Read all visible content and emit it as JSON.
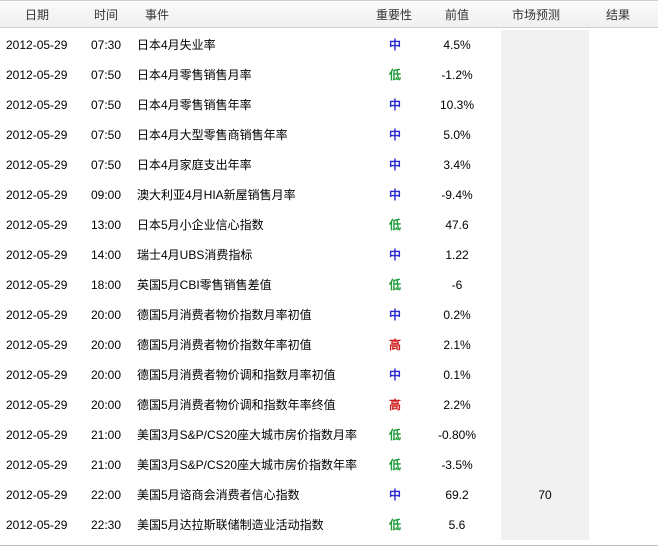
{
  "header": {
    "date": "日期",
    "time": "时间",
    "event": "事件",
    "importance": "重要性",
    "previous": "前值",
    "forecast": "市场预测",
    "actual": "结果"
  },
  "importance_colors": {
    "中": "#2a2ad0",
    "低": "#1f9a3a",
    "高": "#d01c1c"
  },
  "rows": [
    {
      "date": "2012-05-29",
      "time": "07:30",
      "event": "日本4月失业率",
      "importance": "中",
      "previous": "4.5%",
      "forecast": "",
      "actual": ""
    },
    {
      "date": "2012-05-29",
      "time": "07:50",
      "event": "日本4月零售销售月率",
      "importance": "低",
      "previous": "-1.2%",
      "forecast": "",
      "actual": ""
    },
    {
      "date": "2012-05-29",
      "time": "07:50",
      "event": "日本4月零售销售年率",
      "importance": "中",
      "previous": "10.3%",
      "forecast": "",
      "actual": ""
    },
    {
      "date": "2012-05-29",
      "time": "07:50",
      "event": "日本4月大型零售商销售年率",
      "importance": "中",
      "previous": "5.0%",
      "forecast": "",
      "actual": ""
    },
    {
      "date": "2012-05-29",
      "time": "07:50",
      "event": "日本4月家庭支出年率",
      "importance": "中",
      "previous": "3.4%",
      "forecast": "",
      "actual": ""
    },
    {
      "date": "2012-05-29",
      "time": "09:00",
      "event": "澳大利亚4月HIA新屋销售月率",
      "importance": "中",
      "previous": "-9.4%",
      "forecast": "",
      "actual": ""
    },
    {
      "date": "2012-05-29",
      "time": "13:00",
      "event": "日本5月小企业信心指数",
      "importance": "低",
      "previous": "47.6",
      "forecast": "",
      "actual": ""
    },
    {
      "date": "2012-05-29",
      "time": "14:00",
      "event": "瑞士4月UBS消费指标",
      "importance": "中",
      "previous": "1.22",
      "forecast": "",
      "actual": ""
    },
    {
      "date": "2012-05-29",
      "time": "18:00",
      "event": "英国5月CBI零售销售差值",
      "importance": "低",
      "previous": "-6",
      "forecast": "",
      "actual": ""
    },
    {
      "date": "2012-05-29",
      "time": "20:00",
      "event": "德国5月消费者物价指数月率初值",
      "importance": "中",
      "previous": "0.2%",
      "forecast": "",
      "actual": ""
    },
    {
      "date": "2012-05-29",
      "time": "20:00",
      "event": "德国5月消费者物价指数年率初值",
      "importance": "高",
      "previous": "2.1%",
      "forecast": "",
      "actual": ""
    },
    {
      "date": "2012-05-29",
      "time": "20:00",
      "event": "德国5月消费者物价调和指数月率初值",
      "importance": "中",
      "previous": "0.1%",
      "forecast": "",
      "actual": ""
    },
    {
      "date": "2012-05-29",
      "time": "20:00",
      "event": "德国5月消费者物价调和指数年率终值",
      "importance": "高",
      "previous": "2.2%",
      "forecast": "",
      "actual": ""
    },
    {
      "date": "2012-05-29",
      "time": "21:00",
      "event": "美国3月S&P/CS20座大城市房价指数月率",
      "importance": "低",
      "previous": "-0.80%",
      "forecast": "",
      "actual": ""
    },
    {
      "date": "2012-05-29",
      "time": "21:00",
      "event": "美国3月S&P/CS20座大城市房价指数年率",
      "importance": "低",
      "previous": "-3.5%",
      "forecast": "",
      "actual": ""
    },
    {
      "date": "2012-05-29",
      "time": "22:00",
      "event": "美国5月谘商会消费者信心指数",
      "importance": "中",
      "previous": "69.2",
      "forecast": "70",
      "actual": ""
    },
    {
      "date": "2012-05-29",
      "time": "22:30",
      "event": "美国5月达拉斯联储制造业活动指数",
      "importance": "低",
      "previous": "5.6",
      "forecast": "",
      "actual": ""
    }
  ]
}
